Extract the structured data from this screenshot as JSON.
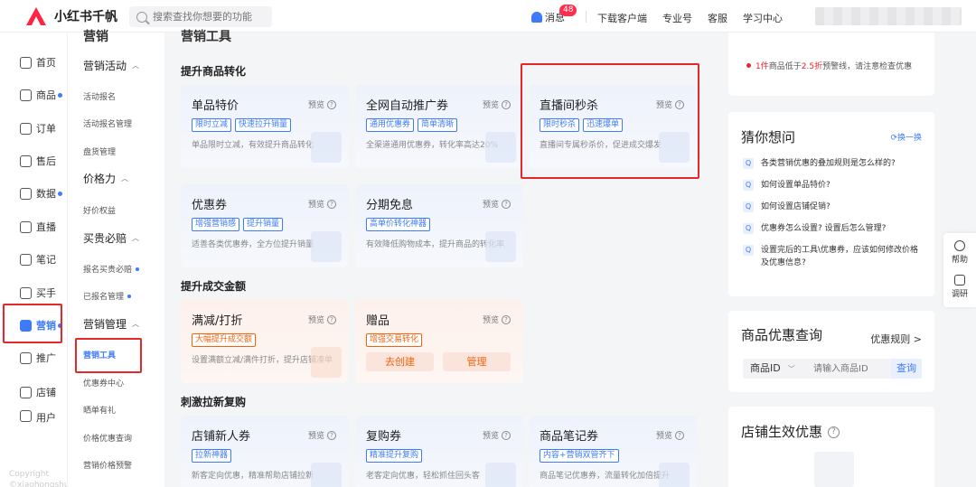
{
  "app": {
    "name": "小红书千帆"
  },
  "search": {
    "placeholder": "搜索查找你想要的功能"
  },
  "topbar": {
    "message_label": "消息",
    "message_count": "48",
    "links": [
      "下载客户端",
      "专业号",
      "客服",
      "学习中心"
    ]
  },
  "nav_primary": [
    {
      "label": "首页",
      "dot": false
    },
    {
      "label": "商品",
      "dot": true
    },
    {
      "label": "订单",
      "dot": false
    },
    {
      "label": "售后",
      "dot": false
    },
    {
      "label": "数据",
      "dot": true
    },
    {
      "label": "直播",
      "dot": false
    },
    {
      "label": "笔记",
      "dot": false
    },
    {
      "label": "买手",
      "dot": false
    },
    {
      "label": "营销",
      "dot": true,
      "active": true
    },
    {
      "label": "推广",
      "dot": false
    },
    {
      "label": "店铺",
      "dot": false
    },
    {
      "label": "用户",
      "dot": false
    }
  ],
  "copyright": {
    "line1": "Copyright",
    "line2": "©xiaohongshu"
  },
  "nav_secondary": {
    "cut_title": "营销",
    "groups": [
      {
        "label": "营销活动",
        "items": [
          {
            "label": "活动报名"
          },
          {
            "label": "活动报名管理"
          },
          {
            "label": "盘货管理"
          }
        ]
      },
      {
        "label": "价格力",
        "items": [
          {
            "label": "好价权益"
          }
        ]
      },
      {
        "label": "买贵必赔",
        "items": [
          {
            "label": "报名买贵必赔",
            "dot": true
          },
          {
            "label": "已报名管理",
            "dot": true
          }
        ]
      },
      {
        "label": "营销管理",
        "items": [
          {
            "label": "营销工具",
            "active": true
          },
          {
            "label": "优惠券中心"
          },
          {
            "label": "晒单有礼"
          },
          {
            "label": "价格优惠查询"
          },
          {
            "label": "营销价格预警"
          }
        ]
      }
    ]
  },
  "main": {
    "cut_title": "营销工具",
    "sections": [
      {
        "title": "提升商品转化",
        "cards": [
          {
            "title": "单品特价",
            "preview": "预览",
            "tags": [
              "限时立减",
              "快速拉升销量"
            ],
            "desc": "单品限时立减，有效提升商品转化"
          },
          {
            "title": "全网自动推广券",
            "preview": "预览",
            "tags": [
              "通用优惠券",
              "简单清晰"
            ],
            "desc": "全渠道通用优惠券，转化率高达20%"
          },
          {
            "title": "直播间秒杀",
            "preview": "预览",
            "tags": [
              "限时秒杀",
              "迅速爆单"
            ],
            "desc": "直播间专属秒杀价，促进成交爆发"
          },
          {
            "title": "优惠券",
            "preview": "预览",
            "tags": [
              "增强营销感",
              "提升销量"
            ],
            "desc": "适善各类优惠券，全方位提升销量"
          },
          {
            "title": "分期免息",
            "preview": "预览",
            "tags": [
              "高单价转化神器"
            ],
            "desc": "有效降低购物成本，提升商品的转化率"
          }
        ]
      },
      {
        "title": "提升成交金额",
        "cards": [
          {
            "title": "满减/打折",
            "preview": "预览",
            "tags": [
              "大幅提升成交额"
            ],
            "desc": "设置满额立减/满件打折，提升店铺凑单"
          },
          {
            "title": "赠品",
            "preview": "预览",
            "tags": [
              "增强交易转化"
            ],
            "buttons": [
              "去创建",
              "管理"
            ]
          }
        ]
      },
      {
        "title": "刺激拉新复购",
        "cards": [
          {
            "title": "店铺新人券",
            "preview": "预览",
            "tags": [
              "拉新神器"
            ],
            "desc": "新客定向优惠，精准帮助店铺拉新"
          },
          {
            "title": "复购券",
            "preview": "预览",
            "tags": [
              "精准提升复购"
            ],
            "desc": "老客定向优惠，轻松抓住回头客"
          },
          {
            "title": "商品笔记券",
            "preview": "预览",
            "tags": [
              "内容+营销双管齐下"
            ],
            "desc": "商品笔记优惠券，流量转化加倍提升"
          }
        ]
      }
    ]
  },
  "warning": {
    "count": "1件",
    "middle": "商品低于",
    "discount": "2.5折",
    "tail": "预警线，请注意检查优惠"
  },
  "guess": {
    "title": "猜你想问",
    "refresh": "换一换",
    "questions": [
      "各类营销优惠的叠加规则是怎么样的?",
      "如何设置单品特价?",
      "如何设置店铺促销?",
      "优惠券怎么设置? 设置后怎么管理?",
      "设置完后的工具\\优惠券，应该如何修改价格及优惠信息?"
    ]
  },
  "price_query": {
    "title": "商品优惠查询",
    "rule_link": "优惠规则 >",
    "select_value": "商品ID",
    "input_placeholder": "请输入商品ID",
    "button": "查询"
  },
  "store_offers": {
    "title": "店铺生效优惠"
  },
  "helper": {
    "items": [
      "帮助",
      "调研"
    ]
  },
  "colors": {
    "accent": "#3e7bfa",
    "highlight_box": "#e4282c",
    "warm": "#f2630f"
  }
}
